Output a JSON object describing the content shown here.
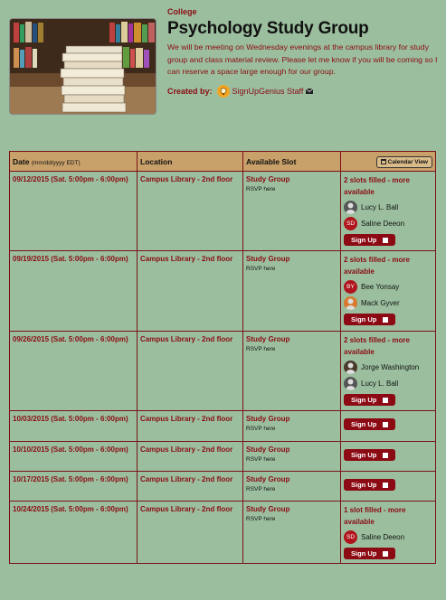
{
  "header": {
    "category": "College",
    "title": "Psychology Study Group",
    "description": "We will be meeting on Wednesday evenings at the campus library for study group and class material review. Please let me know if you will be coming so I can reserve a space large enough for our group.",
    "created_by_label": "Created by:",
    "creator_name": "SignUpGenius Staff",
    "icons": [
      "books-photo",
      "signupgenius-icon",
      "mail-icon"
    ]
  },
  "table": {
    "col_date": "Date",
    "col_date_sub": "(mm/dd/yyyy EDT)",
    "col_location": "Location",
    "col_slot": "Available Slot",
    "calendar_button": "Calendar View",
    "signup_label": "Sign Up",
    "rows": [
      {
        "date": "09/12/2015 (Sat. 5:00pm - 6:00pm)",
        "location": "Campus Library - 2nd floor",
        "slot": "Study Group",
        "rsvp": "RSVP here",
        "filled": "2 slots filled - more available",
        "people": [
          {
            "name": "Lucy L. Ball",
            "avatar": "photo1"
          },
          {
            "name": "Saline Deeon",
            "avatar": "SD"
          }
        ]
      },
      {
        "date": "09/19/2015 (Sat. 5:00pm - 6:00pm)",
        "location": "Campus Library - 2nd floor",
        "slot": "Study Group",
        "rsvp": "RSVP here",
        "filled": "2 slots filled - more available",
        "people": [
          {
            "name": "Bee Yonsay",
            "avatar": "BY"
          },
          {
            "name": "Mack Gyver",
            "avatar": "photo2"
          }
        ]
      },
      {
        "date": "09/26/2015 (Sat. 5:00pm - 6:00pm)",
        "location": "Campus Library - 2nd floor",
        "slot": "Study Group",
        "rsvp": "RSVP here",
        "filled": "2 slots filled - more available",
        "people": [
          {
            "name": "Jorge Washington",
            "avatar": "photo3"
          },
          {
            "name": "Lucy L. Ball",
            "avatar": "photo1"
          }
        ]
      },
      {
        "date": "10/03/2015 (Sat. 5:00pm - 6:00pm)",
        "location": "Campus Library - 2nd floor",
        "slot": "Study Group",
        "rsvp": "RSVP here",
        "filled": "",
        "people": []
      },
      {
        "date": "10/10/2015 (Sat. 5:00pm - 6:00pm)",
        "location": "Campus Library - 2nd floor",
        "slot": "Study Group",
        "rsvp": "RSVP here",
        "filled": "",
        "people": []
      },
      {
        "date": "10/17/2015 (Sat. 5:00pm - 6:00pm)",
        "location": "Campus Library - 2nd floor",
        "slot": "Study Group",
        "rsvp": "RSVP here",
        "filled": "",
        "people": []
      },
      {
        "date": "10/24/2015 (Sat. 5:00pm - 6:00pm)",
        "location": "Campus Library - 2nd floor",
        "slot": "Study Group",
        "rsvp": "RSVP here",
        "filled": "1 slot filled - more available",
        "people": [
          {
            "name": "Saline Deeon",
            "avatar": "SD"
          }
        ]
      }
    ]
  }
}
